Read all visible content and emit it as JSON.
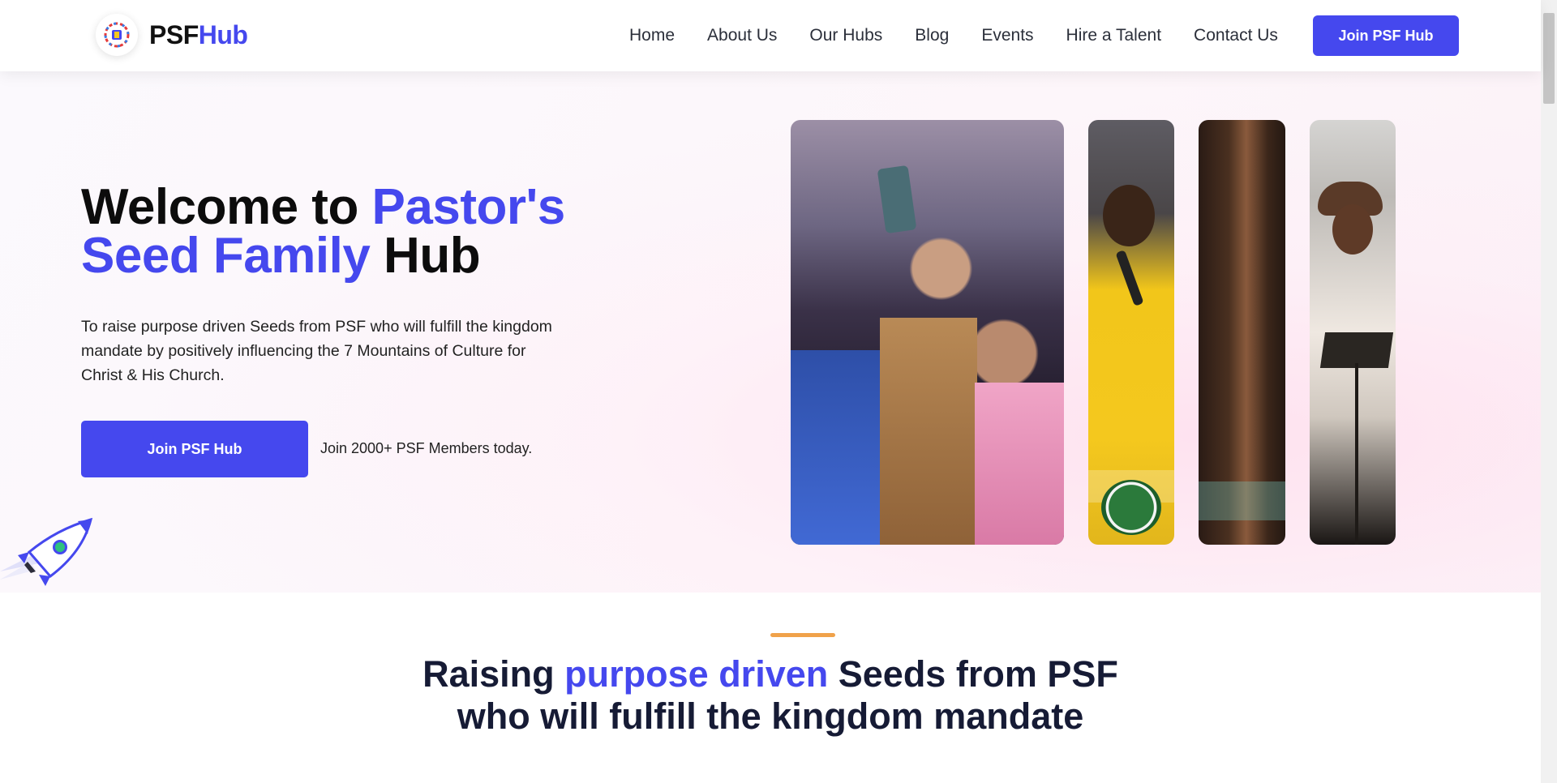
{
  "brand": {
    "name_part1": "PSF",
    "name_part2": "Hub",
    "accent_color": "#4548ee"
  },
  "nav": {
    "items": [
      {
        "label": "Home"
      },
      {
        "label": "About Us"
      },
      {
        "label": "Our Hubs"
      },
      {
        "label": "Blog"
      },
      {
        "label": "Events"
      },
      {
        "label": "Hire a Talent"
      },
      {
        "label": "Contact Us"
      }
    ],
    "cta_label": "Join PSF Hub"
  },
  "hero": {
    "title_part1": "Welcome to ",
    "title_highlight": "Pastor's Seed Family",
    "title_part2": " Hub",
    "description": "To raise purpose driven Seeds from PSF who will fulfill the kingdom mandate by positively influencing the 7 Mountains of Culture for Christ & His Church.",
    "cta_label": "Join PSF Hub",
    "members_text": "Join 2000+ PSF Members today."
  },
  "section2": {
    "title_part1": "Raising ",
    "title_highlight": "purpose driven",
    "title_part2": " Seeds from PSF",
    "title_line2": "who will fulfill the kingdom mandate",
    "accent_line_color": "#f0a24a"
  },
  "icons": {
    "logo": "psf-logo-icon",
    "rocket": "rocket-icon"
  }
}
